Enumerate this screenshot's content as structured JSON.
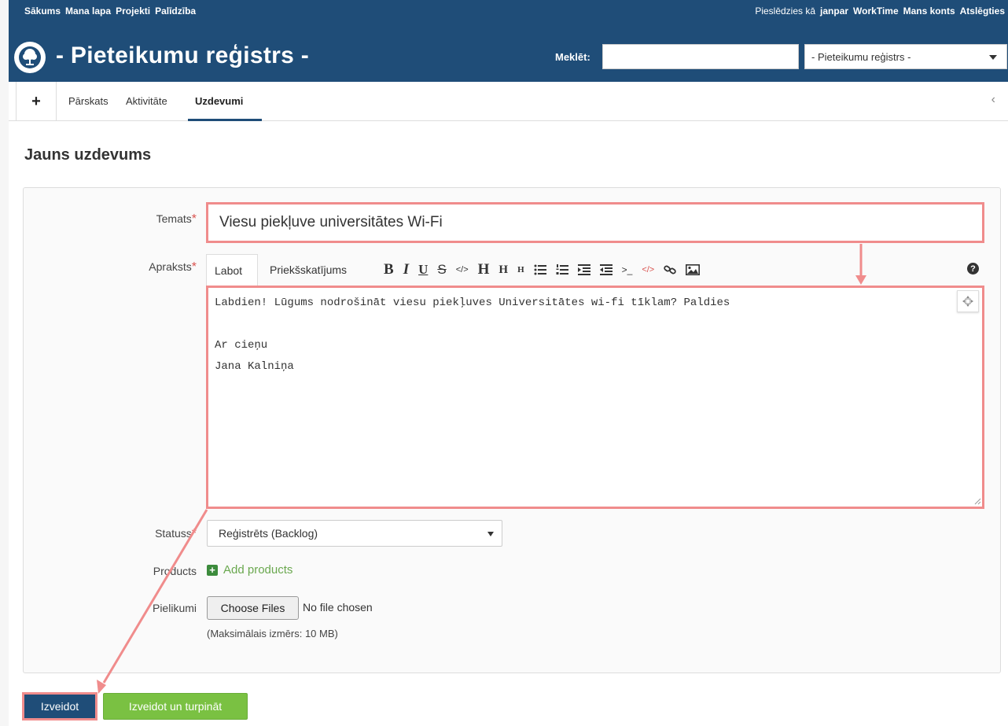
{
  "top_menu": [
    "Sākums",
    "Mana lapa",
    "Projekti",
    "Palīdzība"
  ],
  "account": {
    "logged_in_prefix": "Pieslēdzies kā",
    "username": "janpar",
    "links": [
      "WorkTime",
      "Mans konts",
      "Atslēgties"
    ]
  },
  "header": {
    "title": "- Pieteikumu reģistrs -",
    "search_label": "Meklēt:",
    "search_value": "",
    "project_select": "- Pieteikumu reģistrs -"
  },
  "tabs": {
    "new": "+",
    "items": [
      "Pārskats",
      "Aktivitāte",
      "Uzdevumi"
    ],
    "active": "Uzdevumi",
    "scroll_icon": "‹"
  },
  "page": {
    "heading": "Jauns uzdevums"
  },
  "form": {
    "subject_label": "Temats",
    "subject_value": "Viesu piekļuve universitātes Wi-Fi",
    "required_mark": "*",
    "description_label": "Apraksts",
    "editor_tabs": [
      "Labot",
      "Priekšskatījums"
    ],
    "toolbar": {
      "bold": "B",
      "italic": "I",
      "underline": "U",
      "strike": "S",
      "code_inline": "</>",
      "h1": "H",
      "h2": "H",
      "h3": "H",
      "ul": "ul-icon",
      "ol": "ol-icon",
      "indent": "indent-icon",
      "outdent": "outdent-icon",
      "pre": ">_",
      "code_block": "</>",
      "link": "link-icon",
      "image": "image-icon"
    },
    "help_icon": "?",
    "description_value": "Labdien! Lūgums nodrošināt viesu piekļuves Universitātes wi-fi tīklam? Paldies\n\nAr cieņu\nJana Kalniņa",
    "status_label": "Statuss",
    "status_value": "Reģistrēts (Backlog)",
    "products_label": "Products",
    "add_products": "Add products",
    "attachments_label": "Pielikumi",
    "choose_files": "Choose Files",
    "no_file": "No file chosen",
    "max_size": "(Maksimālais izmērs: 10 MB)"
  },
  "buttons": {
    "create": "Izveidot",
    "create_continue": "Izveidot un turpināt"
  },
  "colors": {
    "header": "#1f4d78",
    "annotation": "#f08c8c",
    "green": "#7ac142",
    "required": "#d9534f"
  }
}
